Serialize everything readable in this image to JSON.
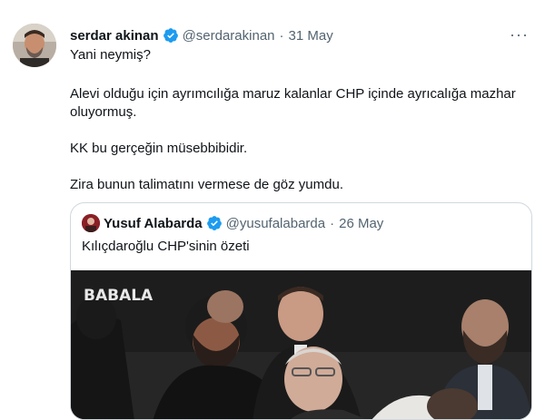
{
  "tweet": {
    "author_name": "serdar akinan",
    "author_handle": "@serdarakinan",
    "separator": "·",
    "date": "31 May",
    "more_label": "···",
    "paragraphs": [
      "Yani neymiş?",
      "Alevi olduğu için ayrımcılığa maruz kalanlar CHP içinde ayrıcalığa mazhar oluyormuş.",
      "KK bu gerçeğin müsebbibidir.",
      "Zira bunun talimatını vermese de göz yumdu."
    ]
  },
  "quoted_tweet": {
    "author_name": "Yusuf Alabarda",
    "author_handle": "@yusufalabarda",
    "separator": "·",
    "date": "26 May",
    "text": "Kılıçdaroğlu CHP'sinin özeti",
    "media": {
      "watermark": "BABALA",
      "description_icon": "video-thumbnail"
    }
  },
  "colors": {
    "text": "#0f1419",
    "secondary": "#536471",
    "verified": "#1d9bf0",
    "border": "#cfd9de"
  }
}
